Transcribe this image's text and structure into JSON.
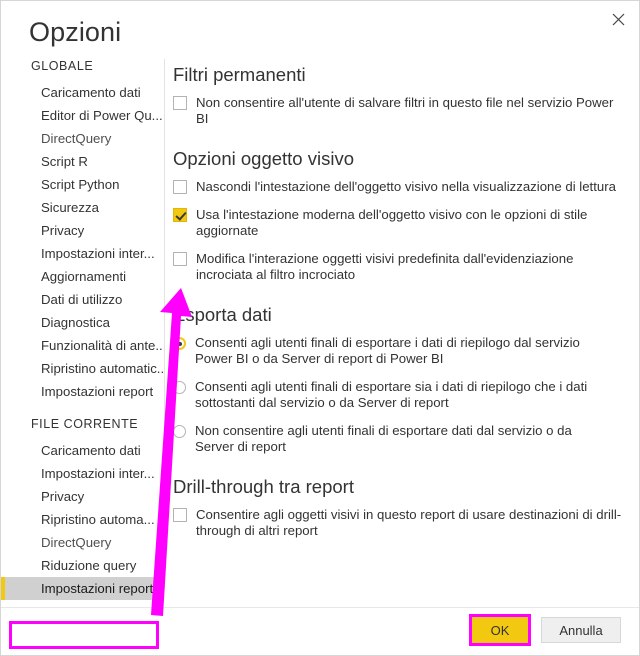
{
  "window": {
    "title": "Opzioni",
    "close_icon": "close-icon"
  },
  "sidebar": {
    "groups": [
      {
        "label": "GLOBALE",
        "items": [
          {
            "label": "Caricamento dati",
            "state": "normal"
          },
          {
            "label": "Editor di Power Qu...",
            "state": "normal"
          },
          {
            "label": "DirectQuery",
            "state": "accent"
          },
          {
            "label": "Script R",
            "state": "normal"
          },
          {
            "label": "Script Python",
            "state": "normal"
          },
          {
            "label": "Sicurezza",
            "state": "normal"
          },
          {
            "label": "Privacy",
            "state": "normal"
          },
          {
            "label": "Impostazioni inter...",
            "state": "normal"
          },
          {
            "label": "Aggiornamenti",
            "state": "normal"
          },
          {
            "label": "Dati di utilizzo",
            "state": "normal"
          },
          {
            "label": "Diagnostica",
            "state": "normal"
          },
          {
            "label": "Funzionalità di ante...",
            "state": "normal"
          },
          {
            "label": "Ripristino automatic...",
            "state": "normal"
          },
          {
            "label": "Impostazioni report",
            "state": "normal"
          }
        ]
      },
      {
        "label": "FILE CORRENTE",
        "items": [
          {
            "label": "Caricamento dati",
            "state": "normal"
          },
          {
            "label": "Impostazioni inter...",
            "state": "normal"
          },
          {
            "label": "Privacy",
            "state": "normal"
          },
          {
            "label": "Ripristino automa...",
            "state": "normal"
          },
          {
            "label": "DirectQuery",
            "state": "accent"
          },
          {
            "label": "Riduzione query",
            "state": "normal"
          },
          {
            "label": "Impostazioni report",
            "state": "selected"
          }
        ]
      }
    ]
  },
  "main": {
    "sections": [
      {
        "heading": "Filtri permanenti",
        "options": [
          {
            "type": "checkbox",
            "checked": false,
            "label": "Non consentire all'utente di salvare filtri in questo file nel servizio Power BI"
          }
        ]
      },
      {
        "heading": "Opzioni oggetto visivo",
        "options": [
          {
            "type": "checkbox",
            "checked": false,
            "label": "Nascondi l'intestazione dell'oggetto visivo nella visualizzazione di lettura"
          },
          {
            "type": "checkbox",
            "checked": true,
            "label": "Usa l'intestazione moderna dell'oggetto visivo con le opzioni di stile aggiornate"
          },
          {
            "type": "checkbox",
            "checked": false,
            "label": "Modifica l'interazione oggetti visivi predefinita dall'evidenziazione incrociata al filtro incrociato"
          }
        ]
      },
      {
        "heading": "Esporta dati",
        "options": [
          {
            "type": "radio",
            "checked": true,
            "label": "Consenti agli utenti finali di esportare i dati di riepilogo dal servizio Power BI o da Server di report di Power BI"
          },
          {
            "type": "radio",
            "checked": false,
            "label": "Consenti agli utenti finali di esportare sia i dati di riepilogo che i dati sottostanti dal servizio o da Server di report"
          },
          {
            "type": "radio",
            "checked": false,
            "label": "Non consentire agli utenti finali di esportare dati dal servizio o da Server di report"
          }
        ]
      },
      {
        "heading": "Drill-through tra report",
        "options": [
          {
            "type": "checkbox",
            "checked": false,
            "label": "Consentire agli oggetti visivi in questo report di usare destinazioni di drill-through di altri report"
          }
        ]
      }
    ]
  },
  "footer": {
    "ok_label": "OK",
    "cancel_label": "Annulla"
  },
  "annotations": {
    "accent_color": "#ff00ff",
    "highlight_color": "#f2c811",
    "arrow": "callout-arrow"
  }
}
